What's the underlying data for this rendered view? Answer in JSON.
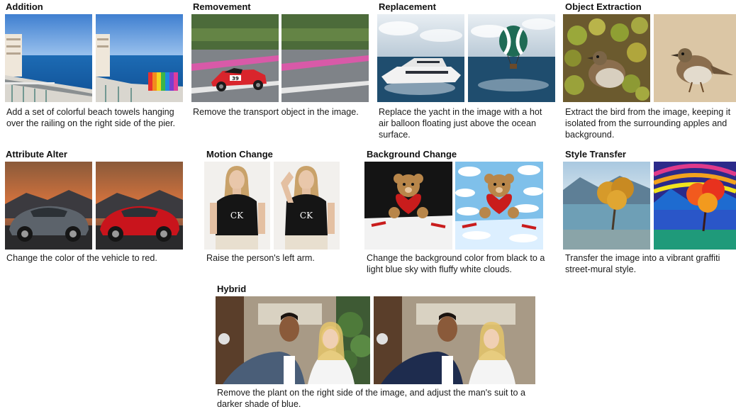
{
  "panels": {
    "addition": {
      "title": "Addition",
      "caption": "Add a set of colorful beach towels hanging over the railing on the right side of the pier."
    },
    "removement": {
      "title": "Removement",
      "caption": "Remove the transport object in the image."
    },
    "replacement": {
      "title": "Replacement",
      "caption": "Replace the yacht in the image with a hot air balloon floating just above the ocean surface."
    },
    "extraction": {
      "title": "Object Extraction",
      "caption": "Extract the bird from the image, keeping it isolated from the surrounding apples and background."
    },
    "attribute": {
      "title": "Attribute Alter",
      "caption": "Change the color of the vehicle to red."
    },
    "motion": {
      "title": "Motion Change",
      "caption": "Raise the person's left arm."
    },
    "background": {
      "title": "Background Change",
      "caption": "Change the background color from black to a light blue sky with fluffy white clouds."
    },
    "style": {
      "title": "Style Transfer",
      "caption": "Transfer the image into a vibrant graffiti street-mural style."
    },
    "hybrid": {
      "title": "Hybrid",
      "caption": "Remove the plant on the right side of the image, and adjust the man's suit to a darker shade of blue."
    }
  },
  "car_text": {
    "number": "39"
  },
  "shirt_text": {
    "logo": "CK"
  }
}
